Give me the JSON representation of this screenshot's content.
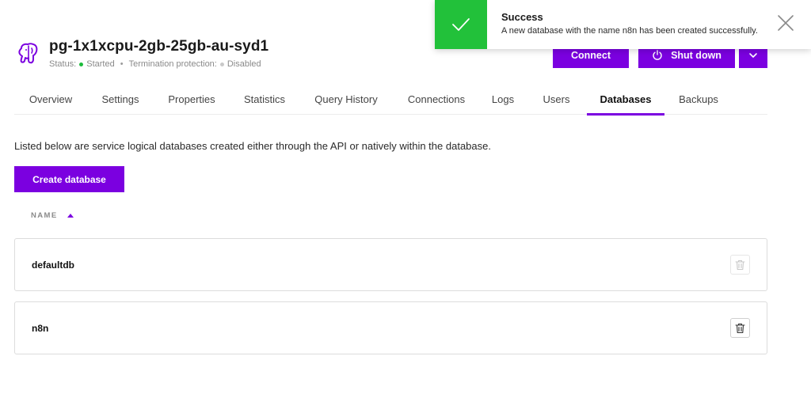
{
  "service": {
    "title": "pg-1x1xcpu-2gb-25gb-au-syd1",
    "status_label": "Status:",
    "status_value": "Started",
    "termination_label": "Termination protection:",
    "termination_value": "Disabled"
  },
  "actions": {
    "connect": "Connect",
    "shutdown": "Shut down"
  },
  "tabs": [
    {
      "label": "Overview"
    },
    {
      "label": "Settings"
    },
    {
      "label": "Properties"
    },
    {
      "label": "Statistics"
    },
    {
      "label": "Query History"
    },
    {
      "label": "Connections"
    },
    {
      "label": "Logs"
    },
    {
      "label": "Users"
    },
    {
      "label": "Databases",
      "active": true
    },
    {
      "label": "Backups"
    }
  ],
  "databases_page": {
    "description": "Listed below are service logical databases created either through the API or natively within the database.",
    "create_button": "Create database",
    "column_name": "NAME",
    "rows": [
      {
        "name": "defaultdb",
        "deletable": false
      },
      {
        "name": "n8n",
        "deletable": true
      }
    ]
  },
  "toast": {
    "title": "Success",
    "message": "A new database with the name n8n has been created successfully."
  },
  "colors": {
    "accent": "#7b00e0",
    "success": "#22c13a",
    "status_started": "#1cbb3b"
  }
}
